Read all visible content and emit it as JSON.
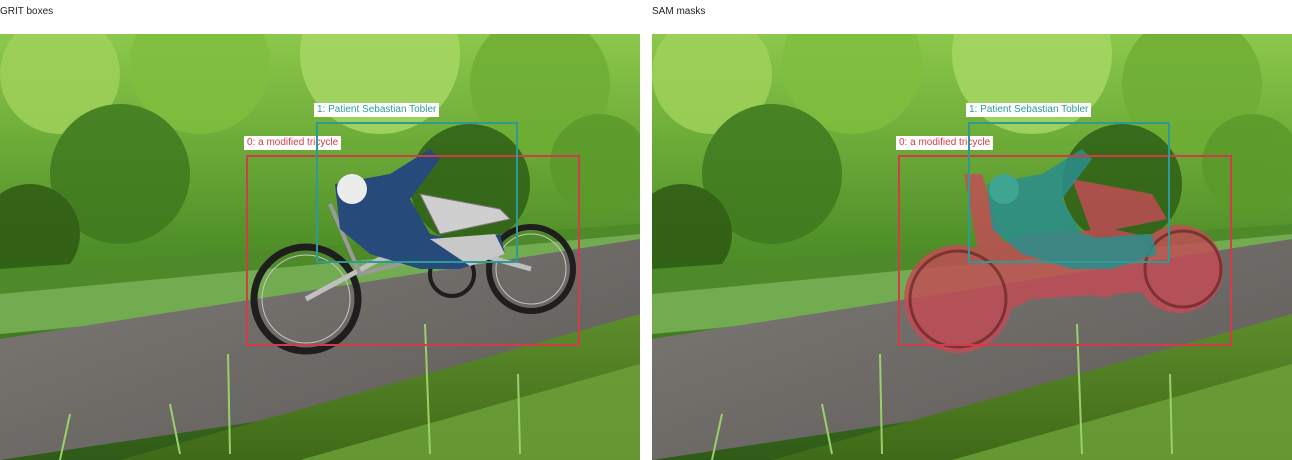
{
  "panels": [
    {
      "title": "GRIT boxes"
    },
    {
      "title": "SAM masks"
    }
  ],
  "detections": [
    {
      "label": "0: a modified tricycle",
      "color": "#d23b48"
    },
    {
      "label": "1: Patient Sebastian Tobler",
      "color": "#2e9a95"
    }
  ],
  "mask_colors": {
    "tricycle": "#c44c55",
    "person": "#2a8e8c"
  }
}
